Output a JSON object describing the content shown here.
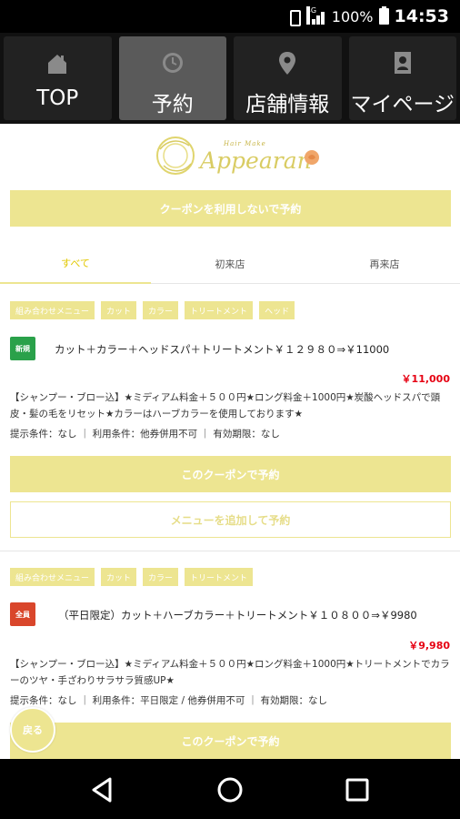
{
  "status_bar": {
    "network": "4G",
    "battery": "100%",
    "time": "14:53"
  },
  "nav": {
    "tabs": [
      {
        "label": "TOP",
        "icon": "home-icon"
      },
      {
        "label": "予約",
        "icon": "clock-icon"
      },
      {
        "label": "店舗情報",
        "icon": "map-pin-icon"
      },
      {
        "label": "マイページ",
        "icon": "id-card-icon"
      }
    ],
    "active_index": 1
  },
  "logo": {
    "small_text": "Hair Make",
    "script_text": "Appearan"
  },
  "no_coupon_button": "クーポンを利用しないで予約",
  "filter_tabs": [
    "すべて",
    "初来店",
    "再来店"
  ],
  "coupons": [
    {
      "tags": [
        "組み合わせメニュー",
        "カット",
        "カラー",
        "トリートメント",
        "ヘッド"
      ],
      "badge": "新規",
      "title": "カット＋カラー＋ヘッドスパ＋トリートメント￥１２９８０⇒￥11000",
      "price": "￥11,000",
      "description": "【シャンプー・ブロー込】★ミディアム料金＋５００円★ロング料金＋1000円★炭酸ヘッドスパで頭皮・髪の毛をリセット★カラーはハーブカラーを使用しております★",
      "conditions": "提示条件：なし ｜ 利用条件：他券併用不可 ｜ 有効期限：なし",
      "use_button": "このクーポンで予約",
      "add_button": "メニューを追加して予約"
    },
    {
      "tags": [
        "組み合わせメニュー",
        "カット",
        "カラー",
        "トリートメント"
      ],
      "badge": "全員",
      "title": "（平日限定）カット＋ハーブカラー＋トリートメント￥１０８００⇒￥9980",
      "price": "￥9,980",
      "description": "【シャンプー・ブロー込】★ミディアム料金＋５００円★ロング料金＋1000円★トリートメントでカラーのツヤ・手ざわりサラサラ質感UP★",
      "conditions": "提示条件：なし ｜ 利用条件：平日限定 / 他券併用不可 ｜ 有効期限：なし",
      "use_button": "このクーポンで予約"
    }
  ],
  "back_button": "戻る",
  "colors": {
    "accent_yellow": "#ede591",
    "price_red": "#e60012",
    "badge_new": "#2aa14a",
    "badge_all": "#d9462b"
  }
}
